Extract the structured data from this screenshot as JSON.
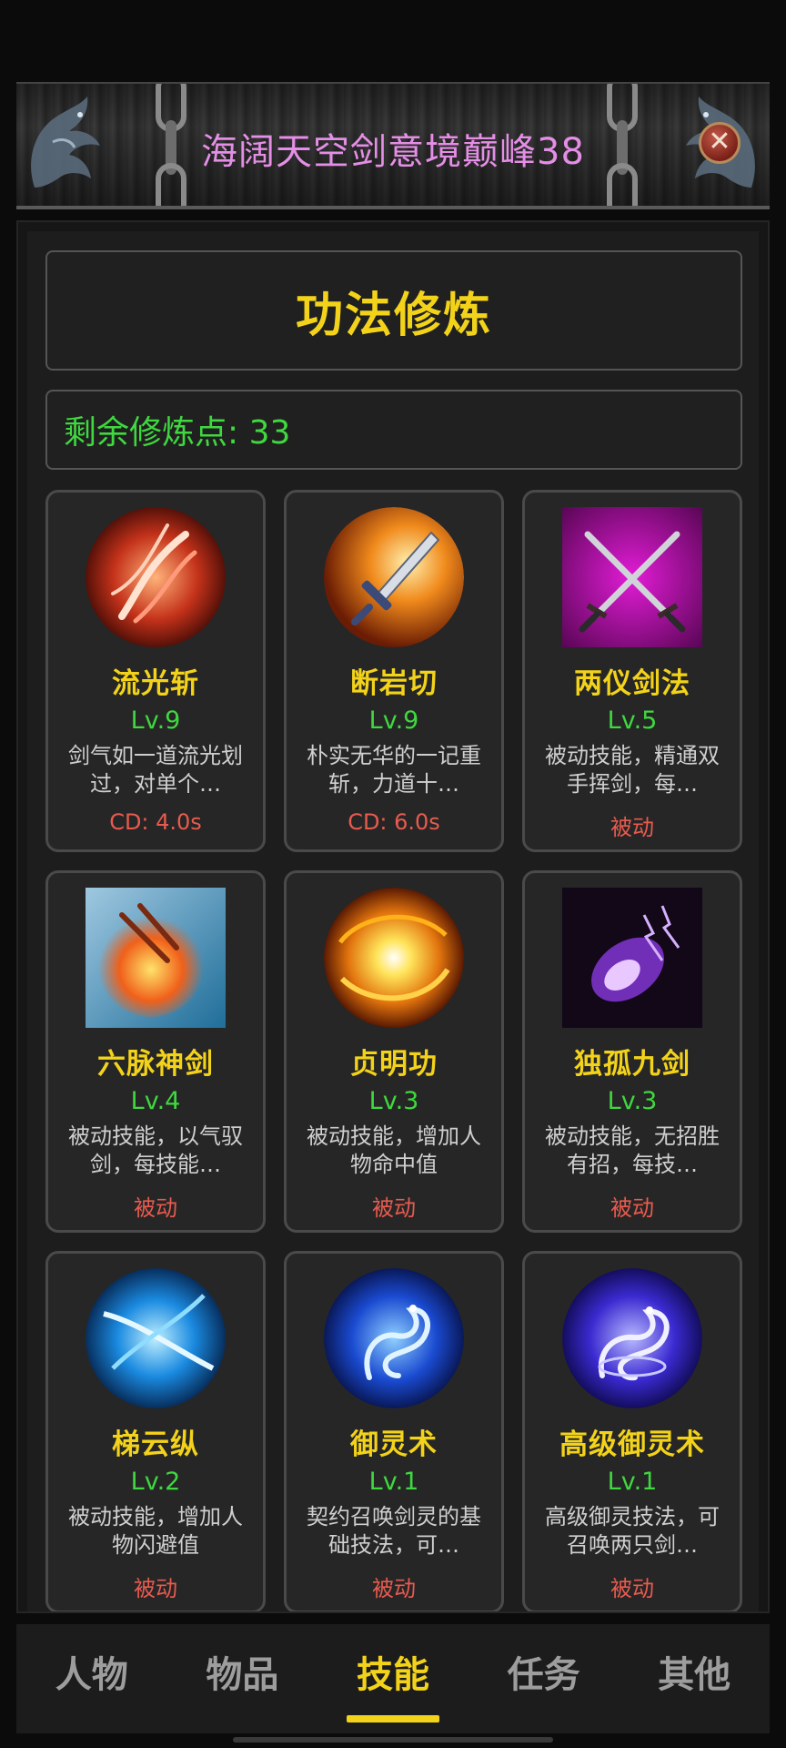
{
  "header": {
    "title": "海阔天空剑意境巅峰38",
    "close_icon": "close-icon"
  },
  "panel": {
    "title": "功法修炼",
    "points_text": "剩余修炼点: 33"
  },
  "skills": [
    {
      "name": "流光斩",
      "level": "Lv.9",
      "desc": "剑气如一道流光划过，对单个…",
      "tag": "CD: 4.0s",
      "icon": "light-slash-icon"
    },
    {
      "name": "断岩切",
      "level": "Lv.9",
      "desc": "朴实无华的一记重斩，力道十…",
      "tag": "CD: 6.0s",
      "icon": "flaming-sword-icon"
    },
    {
      "name": "两仪剑法",
      "level": "Lv.5",
      "desc": "被动技能，精通双手挥剑，每…",
      "tag": "被动",
      "icon": "crossed-swords-icon"
    },
    {
      "name": "六脉神剑",
      "level": "Lv.4",
      "desc": "被动技能，以气驭剑，每技能…",
      "tag": "被动",
      "icon": "fire-burst-icon"
    },
    {
      "name": "贞明功",
      "level": "Lv.3",
      "desc": "被动技能，增加人物命中值",
      "tag": "被动",
      "icon": "sun-orb-icon"
    },
    {
      "name": "独孤九剑",
      "level": "Lv.3",
      "desc": "被动技能，无招胜有招，每技…",
      "tag": "被动",
      "icon": "purple-lightning-icon"
    },
    {
      "name": "梯云纵",
      "level": "Lv.2",
      "desc": "被动技能，增加人物闪避值",
      "tag": "被动",
      "icon": "blue-swirl-icon"
    },
    {
      "name": "御灵术",
      "level": "Lv.1",
      "desc": "契约召唤剑灵的基础技法，可…",
      "tag": "被动",
      "icon": "spirit-dragon-icon"
    },
    {
      "name": "高级御灵术",
      "level": "Lv.1",
      "desc": "高级御灵技法，可召唤两只剑…",
      "tag": "被动",
      "icon": "advanced-spirit-dragon-icon"
    }
  ],
  "nav": {
    "tabs": [
      {
        "label": "人物",
        "active": false
      },
      {
        "label": "物品",
        "active": false
      },
      {
        "label": "技能",
        "active": true
      },
      {
        "label": "任务",
        "active": false
      },
      {
        "label": "其他",
        "active": false
      }
    ]
  },
  "colors": {
    "accent_yellow": "#f3d31a",
    "level_green": "#3fd83f",
    "tag_red": "#e85b4f",
    "title_pink": "#e48ee6"
  }
}
